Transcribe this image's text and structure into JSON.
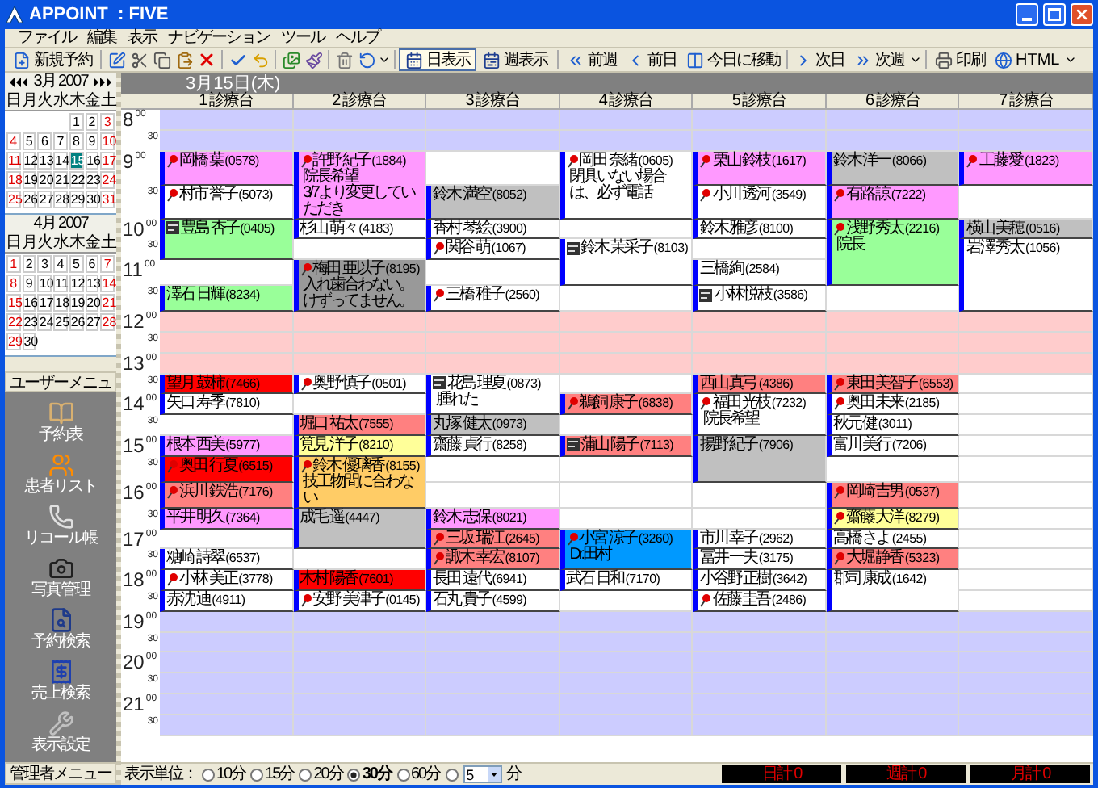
{
  "window": {
    "title": "APPOINT  : FIVE"
  },
  "menu": [
    "ファイル",
    "編集",
    "表示",
    "ナビゲーション",
    "ツール",
    "ヘルプ"
  ],
  "toolbar": {
    "new_button": "新規予約",
    "views": [
      {
        "label": "日表示",
        "selected": true
      },
      {
        "label": "週表示",
        "selected": false
      }
    ],
    "nav": [
      {
        "label": "前週",
        "kind": "prev-week"
      },
      {
        "label": "前日",
        "kind": "prev-day"
      },
      {
        "label": "今日に移動",
        "kind": "today"
      },
      {
        "label": "次日",
        "kind": "next-day"
      },
      {
        "label": "次週",
        "kind": "next-week"
      }
    ],
    "print": "印刷",
    "html": "HTML"
  },
  "calendars": [
    {
      "title": "3月 2007",
      "has_nav": true,
      "weekdays": [
        "日",
        "月",
        "火",
        "水",
        "木",
        "金",
        "土"
      ],
      "weeks": [
        [
          {
            "kind": "blank"
          },
          {
            "kind": "blank"
          },
          {
            "kind": "blank"
          },
          {
            "kind": "blank"
          },
          {
            "kind": "day",
            "day": "1",
            "selected": false
          },
          {
            "kind": "day",
            "day": "2",
            "selected": false
          },
          {
            "kind": "day",
            "day": "3",
            "selected": false
          }
        ],
        [
          {
            "kind": "day",
            "day": "4",
            "selected": false
          },
          {
            "kind": "day",
            "day": "5",
            "selected": false
          },
          {
            "kind": "day",
            "day": "6",
            "selected": false
          },
          {
            "kind": "day",
            "day": "7",
            "selected": false
          },
          {
            "kind": "day",
            "day": "8",
            "selected": false
          },
          {
            "kind": "day",
            "day": "9",
            "selected": false
          },
          {
            "kind": "day",
            "day": "10",
            "selected": false
          }
        ],
        [
          {
            "kind": "day",
            "day": "11",
            "selected": false
          },
          {
            "kind": "day",
            "day": "12",
            "selected": false
          },
          {
            "kind": "day",
            "day": "13",
            "selected": false
          },
          {
            "kind": "day",
            "day": "14",
            "selected": false
          },
          {
            "kind": "day",
            "day": "15",
            "selected": true
          },
          {
            "kind": "day",
            "day": "16",
            "selected": false
          },
          {
            "kind": "day",
            "day": "17",
            "selected": false
          }
        ],
        [
          {
            "kind": "day",
            "day": "18",
            "selected": false
          },
          {
            "kind": "day",
            "day": "19",
            "selected": false
          },
          {
            "kind": "day",
            "day": "20",
            "selected": false
          },
          {
            "kind": "day",
            "day": "21",
            "selected": false
          },
          {
            "kind": "day",
            "day": "22",
            "selected": false
          },
          {
            "kind": "day",
            "day": "23",
            "selected": false
          },
          {
            "kind": "day",
            "day": "24",
            "selected": false
          }
        ],
        [
          {
            "kind": "day",
            "day": "25",
            "selected": false
          },
          {
            "kind": "day",
            "day": "26",
            "selected": false
          },
          {
            "kind": "day",
            "day": "27",
            "selected": false
          },
          {
            "kind": "day",
            "day": "28",
            "selected": false
          },
          {
            "kind": "day",
            "day": "29",
            "selected": false
          },
          {
            "kind": "day",
            "day": "30",
            "selected": false
          },
          {
            "kind": "day",
            "day": "31",
            "selected": false
          }
        ]
      ]
    },
    {
      "title": "4月 2007",
      "has_nav": false,
      "weekdays": [
        "日",
        "月",
        "火",
        "水",
        "木",
        "金",
        "土"
      ],
      "weeks": [
        [
          {
            "kind": "day",
            "day": "1",
            "selected": false
          },
          {
            "kind": "day",
            "day": "2",
            "selected": false
          },
          {
            "kind": "day",
            "day": "3",
            "selected": false
          },
          {
            "kind": "day",
            "day": "4",
            "selected": false
          },
          {
            "kind": "day",
            "day": "5",
            "selected": false
          },
          {
            "kind": "day",
            "day": "6",
            "selected": false
          },
          {
            "kind": "day",
            "day": "7",
            "selected": false
          }
        ],
        [
          {
            "kind": "day",
            "day": "8",
            "selected": false
          },
          {
            "kind": "day",
            "day": "9",
            "selected": false
          },
          {
            "kind": "day",
            "day": "10",
            "selected": false
          },
          {
            "kind": "day",
            "day": "11",
            "selected": false
          },
          {
            "kind": "day",
            "day": "12",
            "selected": false
          },
          {
            "kind": "day",
            "day": "13",
            "selected": false
          },
          {
            "kind": "day",
            "day": "14",
            "selected": false
          }
        ],
        [
          {
            "kind": "day",
            "day": "15",
            "selected": false
          },
          {
            "kind": "day",
            "day": "16",
            "selected": false
          },
          {
            "kind": "day",
            "day": "17",
            "selected": false
          },
          {
            "kind": "day",
            "day": "18",
            "selected": false
          },
          {
            "kind": "day",
            "day": "19",
            "selected": false
          },
          {
            "kind": "day",
            "day": "20",
            "selected": false
          },
          {
            "kind": "day",
            "day": "21",
            "selected": false
          }
        ],
        [
          {
            "kind": "day",
            "day": "22",
            "selected": false
          },
          {
            "kind": "day",
            "day": "23",
            "selected": false
          },
          {
            "kind": "day",
            "day": "24",
            "selected": false
          },
          {
            "kind": "day",
            "day": "25",
            "selected": false
          },
          {
            "kind": "day",
            "day": "26",
            "selected": false
          },
          {
            "kind": "day",
            "day": "27",
            "selected": false
          },
          {
            "kind": "day",
            "day": "28",
            "selected": false
          }
        ],
        [
          {
            "kind": "day",
            "day": "29",
            "selected": false
          },
          {
            "kind": "day",
            "day": "30",
            "selected": false
          },
          {
            "kind": "blank"
          },
          {
            "kind": "blank"
          },
          {
            "kind": "blank"
          },
          {
            "kind": "blank"
          },
          {
            "kind": "blank"
          }
        ]
      ]
    }
  ],
  "user_menu": {
    "title": "ユーザーメニュー",
    "items": [
      {
        "label": "予約表",
        "kind": "book"
      },
      {
        "label": "患者リスト",
        "kind": "people"
      },
      {
        "label": "リコール帳",
        "kind": "phone"
      },
      {
        "label": "写真管理",
        "kind": "camera"
      },
      {
        "label": "予約検索",
        "kind": "search"
      },
      {
        "label": "売上検索",
        "kind": "sales"
      },
      {
        "label": "表示設定",
        "kind": "tools"
      }
    ]
  },
  "admin_menu": "管理者メニュー",
  "date": "3月15日(木)",
  "time_slots": [
    {
      "hour": "8",
      "minute": "00",
      "kind": "closed"
    },
    {
      "minute": "30",
      "kind": "closed"
    },
    {
      "hour": "9",
      "minute": "00",
      "kind": "open"
    },
    {
      "minute": "30",
      "kind": "open"
    },
    {
      "hour": "10",
      "minute": "00",
      "kind": "open"
    },
    {
      "minute": "30",
      "kind": "open"
    },
    {
      "hour": "11",
      "minute": "00",
      "kind": "open"
    },
    {
      "minute": "30",
      "kind": "open"
    },
    {
      "hour": "12",
      "minute": "00",
      "kind": "break"
    },
    {
      "minute": "30",
      "kind": "break"
    },
    {
      "hour": "13",
      "minute": "00",
      "kind": "break"
    },
    {
      "minute": "30",
      "kind": "open"
    },
    {
      "hour": "14",
      "minute": "00",
      "kind": "open"
    },
    {
      "minute": "30",
      "kind": "open"
    },
    {
      "hour": "15",
      "minute": "00",
      "kind": "open"
    },
    {
      "minute": "30",
      "kind": "open"
    },
    {
      "hour": "16",
      "minute": "00",
      "kind": "open"
    },
    {
      "minute": "30",
      "kind": "open"
    },
    {
      "hour": "17",
      "minute": "00",
      "kind": "open"
    },
    {
      "minute": "30",
      "kind": "open"
    },
    {
      "hour": "18",
      "minute": "00",
      "kind": "open"
    },
    {
      "minute": "30",
      "kind": "open"
    },
    {
      "hour": "19",
      "minute": "00",
      "kind": "closed"
    },
    {
      "minute": "30",
      "kind": "closed"
    },
    {
      "hour": "20",
      "minute": "00",
      "kind": "closed"
    },
    {
      "minute": "30",
      "kind": "closed"
    },
    {
      "hour": "21",
      "minute": "00",
      "kind": "closed"
    },
    {
      "minute": "30",
      "kind": "closed"
    }
  ],
  "columns": [
    {
      "title": "1 診療台",
      "entries": [
        {
          "kind": "pinned",
          "name": "岡橋 葉",
          "code": "(0578)",
          "color": "#ff99ff"
        },
        {
          "kind": "pinned",
          "name": "村市 誉子",
          "code": "(5073)",
          "color": "#ffffff"
        },
        {
          "kind": "card",
          "name": "豊島 杏子",
          "code": "(0405)",
          "color": "#99ff99"
        },
        {
          "kind": "continued"
        },
        {
          "kind": "empty"
        },
        {
          "kind": "plain",
          "name": "澤石 日輝",
          "code": "(8234)",
          "color": "#99ff99"
        },
        {
          "kind": "plain",
          "name": "望月 鼓柿",
          "code": "(7466)",
          "color": "#ff0000"
        },
        {
          "kind": "plain",
          "name": "矢口 寿季",
          "code": "(7810)",
          "color": "#ffffff"
        },
        {
          "kind": "empty"
        },
        {
          "kind": "plain",
          "name": "根本 西美",
          "code": "(5977)",
          "color": "#ff99ff"
        },
        {
          "kind": "pinned",
          "name": "奥田 行夏",
          "code": "(6515)",
          "color": "#ff0000"
        },
        {
          "kind": "pinned",
          "name": "浜川 鉄浩",
          "code": "(7176)",
          "color": "#ff8080"
        },
        {
          "kind": "plain",
          "name": "平井 明久",
          "code": "(7364)",
          "color": "#ff99ff"
        },
        {
          "kind": "empty"
        },
        {
          "kind": "plain",
          "name": "糖崎 詩翠",
          "code": "(6537)",
          "color": "#ffffff"
        },
        {
          "kind": "pinned",
          "name": "小林 美正",
          "code": "(3778)",
          "color": "#ffffff"
        },
        {
          "kind": "plain",
          "name": "赤沈 迪",
          "code": "(4911)",
          "color": "#ffffff"
        }
      ]
    },
    {
      "title": "2 診療台",
      "entries": [
        {
          "kind": "pinned",
          "name": "許野 紀子",
          "code": "(1884)",
          "color": "#ff99ff",
          "notes": [
            "院長希望",
            "3/7より変更していただき"
          ]
        },
        {
          "kind": "continued"
        },
        {
          "kind": "plain",
          "name": "杉山 萌々",
          "code": "(4183)",
          "color": "#ffffff"
        },
        {
          "kind": "empty"
        },
        {
          "kind": "pinned",
          "name": "梅田 亜以子",
          "code": "(8195)",
          "color": "#999999",
          "notes": [
            "入れ歯合わない。けずってません。"
          ]
        },
        {
          "kind": "continued"
        },
        {
          "kind": "pinned",
          "name": "奥野 慎子",
          "code": "(0501)",
          "color": "#ffffff"
        },
        {
          "kind": "empty"
        },
        {
          "kind": "plain",
          "name": "堀口 祐太",
          "code": "(7555)",
          "color": "#ff8080"
        },
        {
          "kind": "plain",
          "name": "筧見 洋子",
          "code": "(8210)",
          "color": "#ffff99"
        },
        {
          "kind": "pinned",
          "name": "鈴木 優璃香",
          "code": "(8155)",
          "color": "#ffcc66",
          "notes": [
            "技工物間に合わない"
          ]
        },
        {
          "kind": "continued"
        },
        {
          "kind": "plain",
          "name": "成毛 遥",
          "code": "(4447)",
          "color": "#c0c0c0"
        },
        {
          "kind": "continued"
        },
        {
          "kind": "empty"
        },
        {
          "kind": "plain",
          "name": "木村 陽香",
          "code": "(7601)",
          "color": "#ff0000"
        },
        {
          "kind": "pinned",
          "name": "安野 美津子",
          "code": "(0145)",
          "color": "#ffffff"
        }
      ]
    },
    {
      "title": "3 診療台",
      "entries": [
        {
          "kind": "empty"
        },
        {
          "kind": "plain",
          "name": "鈴木 満空",
          "code": "(8052)",
          "color": "#c0c0c0"
        },
        {
          "kind": "plain",
          "name": "香村 琴絵",
          "code": "(3900)",
          "color": "#ffffff"
        },
        {
          "kind": "pinned",
          "name": "関谷 萌",
          "code": "(1067)",
          "color": "#ffffff"
        },
        {
          "kind": "empty"
        },
        {
          "kind": "pinned",
          "name": "三橋 稚子",
          "code": "(2560)",
          "color": "#ffffff"
        },
        {
          "kind": "card",
          "name": "花島 理夏",
          "code": "(0873)",
          "color": "#ffffff",
          "notes": [
            "腫れた"
          ]
        },
        {
          "kind": "continued"
        },
        {
          "kind": "plain",
          "name": "丸塚 健太",
          "code": "(0973)",
          "color": "#c0c0c0"
        },
        {
          "kind": "plain",
          "name": "齋藤 貞行",
          "code": "(8258)",
          "color": "#ffffff"
        },
        {
          "kind": "empty"
        },
        {
          "kind": "empty"
        },
        {
          "kind": "plain",
          "name": "鈴木 志保",
          "code": "(8021)",
          "color": "#ff99ff"
        },
        {
          "kind": "pinned",
          "name": "三坂 瑞江",
          "code": "(2645)",
          "color": "#ff8080"
        },
        {
          "kind": "pinned",
          "name": "諏木 幸宏",
          "code": "(8107)",
          "color": "#ff8080"
        },
        {
          "kind": "plain",
          "name": "長田 遠代",
          "code": "(6941)",
          "color": "#ffffff"
        },
        {
          "kind": "plain",
          "name": "石丸 貴子",
          "code": "(4599)",
          "color": "#ffffff"
        }
      ]
    },
    {
      "title": "4 診療台",
      "entries": [
        {
          "kind": "pinned",
          "name": "岡田 奈緒",
          "code": "(0605)",
          "color": "#ffffff",
          "notes": [
            "閉具いない場合は、必ず電話"
          ]
        },
        {
          "kind": "continued"
        },
        {
          "kind": "empty"
        },
        {
          "kind": "card",
          "name": "鈴木 茉采子",
          "code": "(8103)",
          "color": "#ffffff"
        },
        {
          "kind": "continued"
        },
        {
          "kind": "empty"
        },
        {
          "kind": "empty"
        },
        {
          "kind": "pinned",
          "name": "鵜飼 康子",
          "code": "(6838)",
          "color": "#ff8080"
        },
        {
          "kind": "empty"
        },
        {
          "kind": "card",
          "name": "蒲山 陽子",
          "code": "(7113)",
          "color": "#ff8080"
        },
        {
          "kind": "empty"
        },
        {
          "kind": "empty"
        },
        {
          "kind": "empty"
        },
        {
          "kind": "pinned",
          "name": "小宮 涼子",
          "code": "(3260)",
          "color": "#0099ff",
          "notes": [
            "Dr.田村"
          ]
        },
        {
          "kind": "continued"
        },
        {
          "kind": "plain",
          "name": "武石 日和",
          "code": "(7170)",
          "color": "#ffffff"
        },
        {
          "kind": "empty"
        }
      ]
    },
    {
      "title": "5 診療台",
      "entries": [
        {
          "kind": "pinned",
          "name": "栗山 鈴枝",
          "code": "(1617)",
          "color": "#ff99ff"
        },
        {
          "kind": "pinned",
          "name": "小川 透河",
          "code": "(3549)",
          "color": "#ffffff"
        },
        {
          "kind": "plain",
          "name": "鈴木 雅彦",
          "code": "(8100)",
          "color": "#ffffff"
        },
        {
          "kind": "empty"
        },
        {
          "kind": "plain",
          "name": "三橋 絢",
          "code": "(2584)",
          "color": "#ffffff"
        },
        {
          "kind": "card",
          "name": "小林 悦枝",
          "code": "(3586)",
          "color": "#ffffff"
        },
        {
          "kind": "plain",
          "name": "西山 真弓",
          "code": "(4386)",
          "color": "#ff8080"
        },
        {
          "kind": "pinned",
          "name": "福田 光枝",
          "code": "(7232)",
          "color": "#ffffff",
          "notes": [
            "院長希望"
          ]
        },
        {
          "kind": "continued"
        },
        {
          "kind": "plain",
          "name": "揚野 紀子",
          "code": "(7906)",
          "color": "#c0c0c0"
        },
        {
          "kind": "continued"
        },
        {
          "kind": "empty"
        },
        {
          "kind": "empty"
        },
        {
          "kind": "plain",
          "name": "市川 幸子",
          "code": "(2962)",
          "color": "#ffffff"
        },
        {
          "kind": "plain",
          "name": "冨井 一夫",
          "code": "(3175)",
          "color": "#ffffff"
        },
        {
          "kind": "plain",
          "name": "小谷野 正樹",
          "code": "(3642)",
          "color": "#ffffff"
        },
        {
          "kind": "pinned",
          "name": "佐藤 圭吾",
          "code": "(2486)",
          "color": "#ffffff"
        }
      ]
    },
    {
      "title": "6 診療台",
      "entries": [
        {
          "kind": "plain",
          "name": "鈴木 洋一",
          "code": "(8066)",
          "color": "#c0c0c0"
        },
        {
          "kind": "pinned",
          "name": "有路 諒",
          "code": "(7222)",
          "color": "#ff99ff"
        },
        {
          "kind": "pinned",
          "name": "浅野 秀太",
          "code": "(2216)",
          "color": "#99ff99",
          "notes": [
            "院長"
          ]
        },
        {
          "kind": "continued"
        },
        {
          "kind": "continued"
        },
        {
          "kind": "empty"
        },
        {
          "kind": "pinned",
          "name": "東田 美智子",
          "code": "(6553)",
          "color": "#ff8080"
        },
        {
          "kind": "pinned",
          "name": "奥田 未来",
          "code": "(2185)",
          "color": "#ffffff"
        },
        {
          "kind": "plain",
          "name": "秋元 健",
          "code": "(3011)",
          "color": "#ffffff"
        },
        {
          "kind": "plain",
          "name": "富川 美行",
          "code": "(7206)",
          "color": "#ffffff"
        },
        {
          "kind": "empty"
        },
        {
          "kind": "pinned",
          "name": "岡崎 吉男",
          "code": "(0537)",
          "color": "#ff8080"
        },
        {
          "kind": "pinned",
          "name": "齋藤 大洋",
          "code": "(8279)",
          "color": "#ffff99"
        },
        {
          "kind": "plain",
          "name": "高橋 さよ",
          "code": "(2455)",
          "color": "#ffffff"
        },
        {
          "kind": "pinned",
          "name": "大堀 静香",
          "code": "(5323)",
          "color": "#ff8080"
        },
        {
          "kind": "plain",
          "name": "郡司 康成",
          "code": "(1642)",
          "color": "#ffffff"
        },
        {
          "kind": "continued"
        }
      ]
    },
    {
      "title": "7 診療台",
      "entries": [
        {
          "kind": "pinned",
          "name": "工藤 愛",
          "code": "(1823)",
          "color": "#ff99ff"
        },
        {
          "kind": "empty"
        },
        {
          "kind": "plain",
          "name": "横山 美穂",
          "code": "(0516)",
          "color": "#c0c0c0"
        },
        {
          "kind": "plain",
          "name": "岩澤 秀太",
          "code": "(1056)",
          "color": "#ffffff"
        },
        {
          "kind": "continued"
        },
        {
          "kind": "continued"
        },
        {
          "kind": "empty"
        },
        {
          "kind": "empty"
        },
        {
          "kind": "empty"
        },
        {
          "kind": "empty"
        },
        {
          "kind": "empty"
        },
        {
          "kind": "empty"
        },
        {
          "kind": "empty"
        },
        {
          "kind": "empty"
        },
        {
          "kind": "empty"
        },
        {
          "kind": "empty"
        },
        {
          "kind": "empty"
        }
      ]
    }
  ],
  "display_unit": {
    "label": "表示単位：",
    "options": [
      {
        "label": "10分",
        "selected": false
      },
      {
        "label": "15分",
        "selected": false
      },
      {
        "label": "20分",
        "selected": false
      },
      {
        "label": "30分",
        "selected": true
      },
      {
        "label": "60分",
        "selected": false
      }
    ],
    "custom": {
      "selected": false,
      "value": "5",
      "suffix": "分"
    }
  },
  "totals": [
    "日計 0",
    "週計 0",
    "月計 0"
  ]
}
